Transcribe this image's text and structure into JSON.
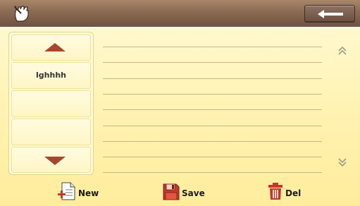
{
  "titlebar": {
    "app_icon": "hand-pen-icon",
    "back_icon": "back-arrow-icon"
  },
  "list": {
    "items": [
      "lghhhh",
      "",
      ""
    ],
    "up_icon": "triangle-up-icon",
    "down_icon": "triangle-down-icon"
  },
  "scroll": {
    "up_icon": "double-chevron-up-icon",
    "down_icon": "double-chevron-down-icon"
  },
  "toolbar": {
    "new_label": "New",
    "save_label": "Save",
    "del_label": "Del"
  },
  "colors": {
    "titlebar": "#8b6a52",
    "background": "#fff3b4",
    "arrow": "#a8452e",
    "icon_red": "#c0392b"
  }
}
